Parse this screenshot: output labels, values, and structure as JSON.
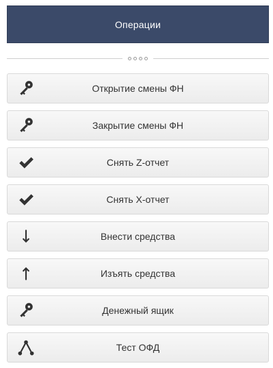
{
  "header": {
    "title": "Операции"
  },
  "menu": {
    "items": [
      {
        "label": "Открытие смены ФН",
        "icon": "key-icon"
      },
      {
        "label": "Закрытие смены ФН",
        "icon": "key-icon"
      },
      {
        "label": "Снять Z-отчет",
        "icon": "check-icon"
      },
      {
        "label": "Снять X-отчет",
        "icon": "check-icon"
      },
      {
        "label": "Внести средства",
        "icon": "arrow-down-icon"
      },
      {
        "label": "Изъять средства",
        "icon": "arrow-up-icon"
      },
      {
        "label": "Денежный ящик",
        "icon": "key-icon"
      },
      {
        "label": "Тест ОФД",
        "icon": "network-icon"
      }
    ]
  },
  "colors": {
    "header_bg": "#3b4a69",
    "button_bg": "#f1f1f1",
    "text": "#333333"
  }
}
